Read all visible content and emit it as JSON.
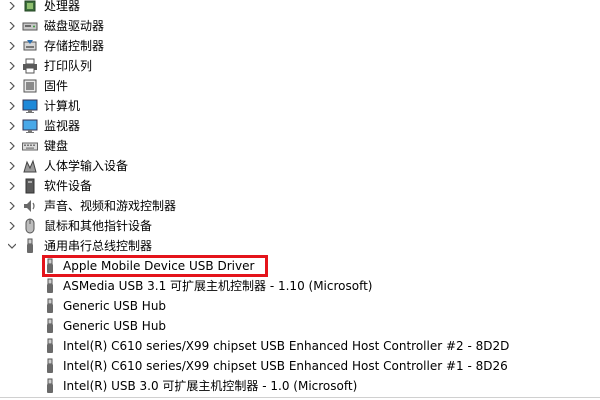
{
  "device_manager": {
    "categories": [
      {
        "label": "处理器",
        "icon": "processor-icon"
      },
      {
        "label": "磁盘驱动器",
        "icon": "disk-drive-icon"
      },
      {
        "label": "存储控制器",
        "icon": "storage-controller-icon"
      },
      {
        "label": "打印队列",
        "icon": "printer-icon"
      },
      {
        "label": "固件",
        "icon": "firmware-icon"
      },
      {
        "label": "计算机",
        "icon": "computer-icon"
      },
      {
        "label": "监视器",
        "icon": "monitor-icon"
      },
      {
        "label": "键盘",
        "icon": "keyboard-icon"
      },
      {
        "label": "人体学输入设备",
        "icon": "hid-icon"
      },
      {
        "label": "软件设备",
        "icon": "software-device-icon"
      },
      {
        "label": "声音、视频和游戏控制器",
        "icon": "audio-icon"
      },
      {
        "label": "鼠标和其他指针设备",
        "icon": "mouse-icon"
      },
      {
        "label": "通用串行总线控制器",
        "icon": "usb-icon",
        "expanded": true
      }
    ],
    "usb_children": [
      {
        "label": "Apple Mobile Device USB Driver",
        "highlighted": true
      },
      {
        "label": "ASMedia USB 3.1 可扩展主机控制器 - 1.10 (Microsoft)"
      },
      {
        "label": "Generic USB Hub"
      },
      {
        "label": "Generic USB Hub"
      },
      {
        "label": "Intel(R) C610 series/X99 chipset USB Enhanced Host Controller #2 - 8D2D"
      },
      {
        "label": "Intel(R) C610 series/X99 chipset USB Enhanced Host Controller #1 - 8D26"
      },
      {
        "label": "Intel(R) USB 3.0 可扩展主机控制器 - 1.0 (Microsoft)"
      }
    ],
    "highlight_color": "#e4141b"
  }
}
